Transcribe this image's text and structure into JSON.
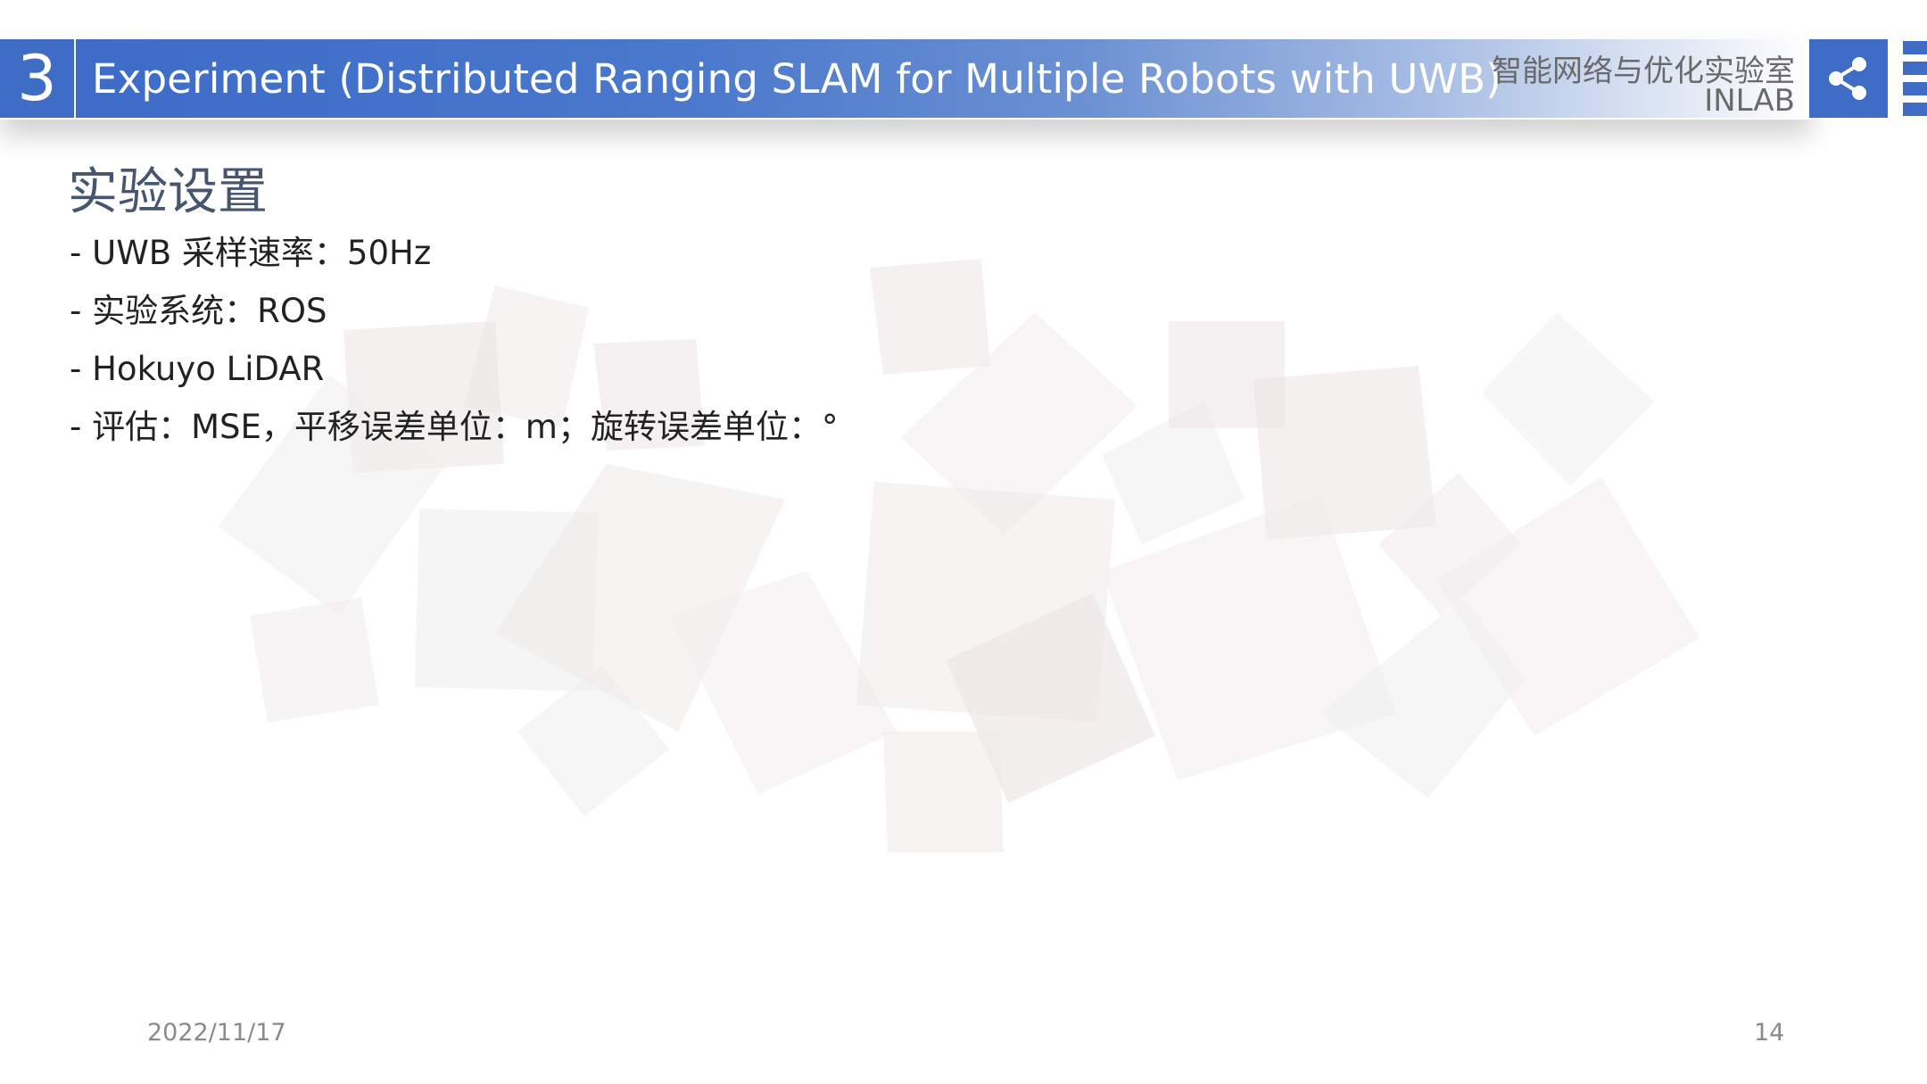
{
  "header": {
    "section_number": "3",
    "title": "Experiment (Distributed Ranging SLAM for Multiple Robots with UWB)",
    "lab_name_cn": "智能网络与优化实验室",
    "lab_name_en": "INLAB",
    "share_icon": "share-icon",
    "accent_color": "#3f6cc4"
  },
  "content": {
    "heading": "实验设置",
    "bullets": [
      "- UWB 采样速率：50Hz",
      "- 实验系统：ROS",
      "- Hokuyo LiDAR",
      "- 评估：MSE，平移误差单位：m；旋转误差单位：°"
    ]
  },
  "footer": {
    "date": "2022/11/17",
    "page_number": "14"
  }
}
